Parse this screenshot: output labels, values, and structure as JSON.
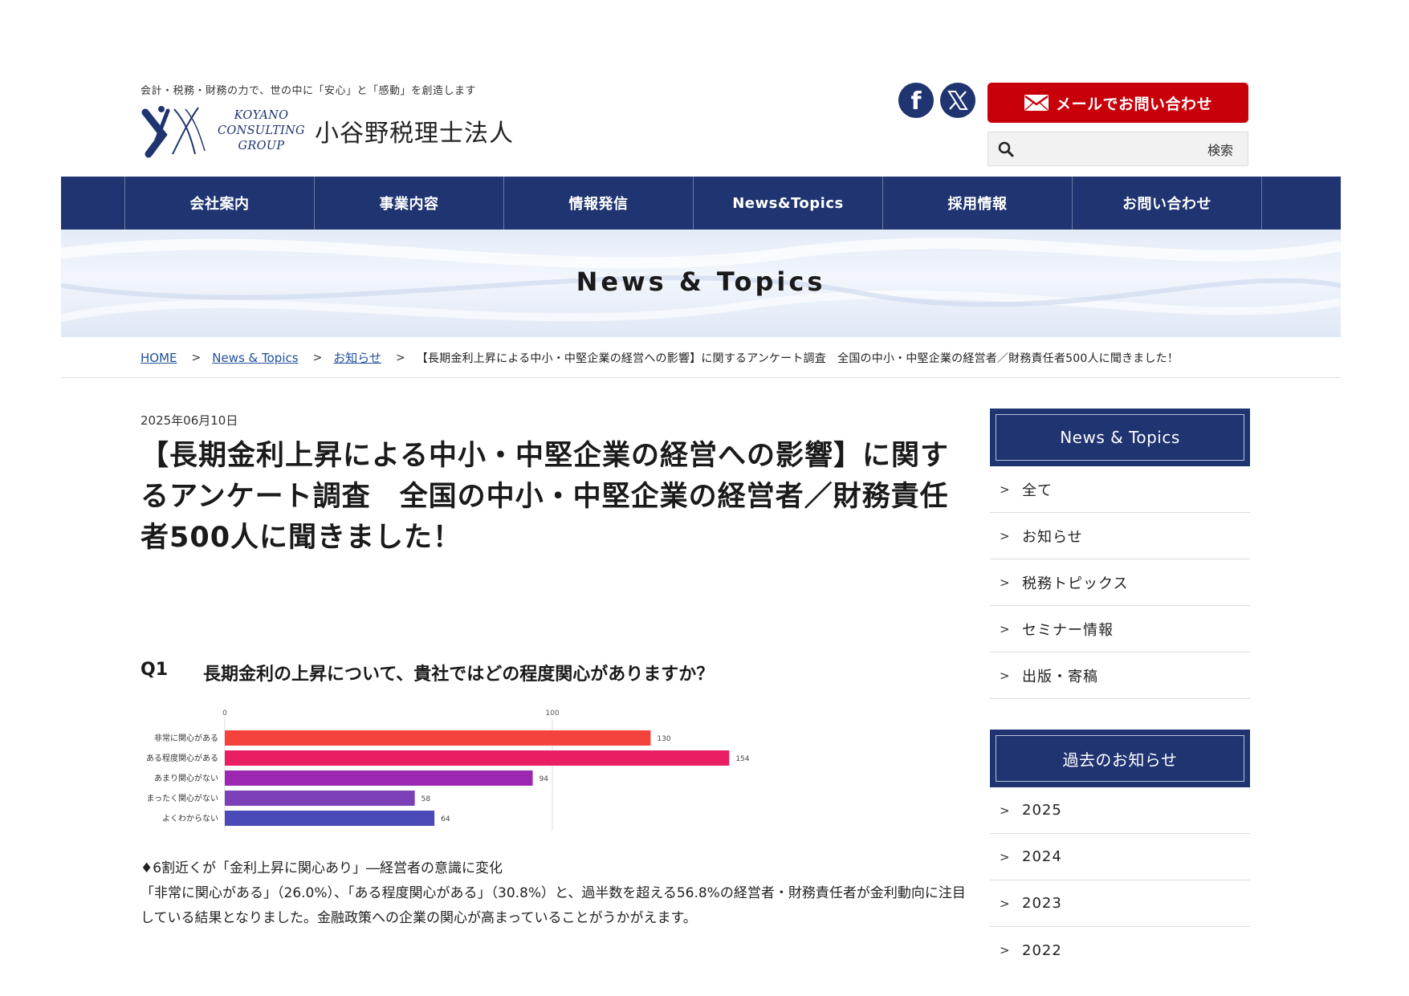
{
  "header": {
    "tagline": "会計・税務・財務の力で、世の中に「安心」と「感動」を創造します",
    "logo_en": [
      "KOYANO",
      "CONSULTING",
      "GROUP"
    ],
    "logo_jp": "小谷野税理士法人",
    "mail_button": "メールでお問い合わせ",
    "search_placeholder": "",
    "search_label": "検索",
    "icons": {
      "facebook": "facebook-icon",
      "x": "x-icon",
      "mail": "mail-icon",
      "search": "search-icon"
    }
  },
  "nav": {
    "items": [
      "会社案内",
      "事業内容",
      "情報発信",
      "News&Topics",
      "採用情報",
      "お問い合わせ"
    ]
  },
  "hero": {
    "title": "News & Topics"
  },
  "breadcrumb": {
    "items": [
      "HOME",
      "News & Topics",
      "お知らせ"
    ],
    "current": "【長期金利上昇による中小・中堅企業の経営への影響】に関するアンケート調査　全国の中小・中堅企業の経営者／財務責任者500人に聞きました！"
  },
  "article": {
    "date": "2025年06月10日",
    "title": "【長期金利上昇による中小・中堅企業の経営への影響】に関するアンケート調査　全国の中小・中堅企業の経営者／財務責任者500人に聞きました！",
    "q1_no": "Q1",
    "q1_text": "長期金利の上昇について、貴社ではどの程度関心がありますか？",
    "summary_heading": "♦6割近くが「金利上昇に関心あり」―経営者の意識に変化",
    "summary_body": "「非常に関心がある」（26.0%）、「ある程度関心がある」（30.8%）と、過半数を超える56.8%の経営者・財務責任者が金利動向に注目している結果となりました。金融政策への企業の関心が高まっていることがうかがえます。"
  },
  "chart_data": {
    "type": "bar",
    "orientation": "horizontal",
    "categories": [
      "非常に関心がある",
      "ある程度関心がある",
      "あまり関心がない",
      "まったく関心がない",
      "よくわからない"
    ],
    "values": [
      130,
      154,
      94,
      58,
      64
    ],
    "colors": [
      "#f4433c",
      "#e91e63",
      "#9c27b0",
      "#7b3fb7",
      "#4a4ab8"
    ],
    "xticks": [
      0,
      100
    ],
    "xlim": [
      0,
      100
    ],
    "grid": true
  },
  "sidebar": {
    "news_title": "News & Topics",
    "news_items": [
      "全て",
      "お知らせ",
      "税務トピックス",
      "セミナー情報",
      "出版・寄稿"
    ],
    "archive_title": "過去のお知らせ",
    "archive_items": [
      "2025",
      "2024",
      "2023",
      "2022"
    ]
  },
  "colors": {
    "navy": "#1f3470",
    "red": "#c8000a",
    "link": "#1f4f9a"
  }
}
